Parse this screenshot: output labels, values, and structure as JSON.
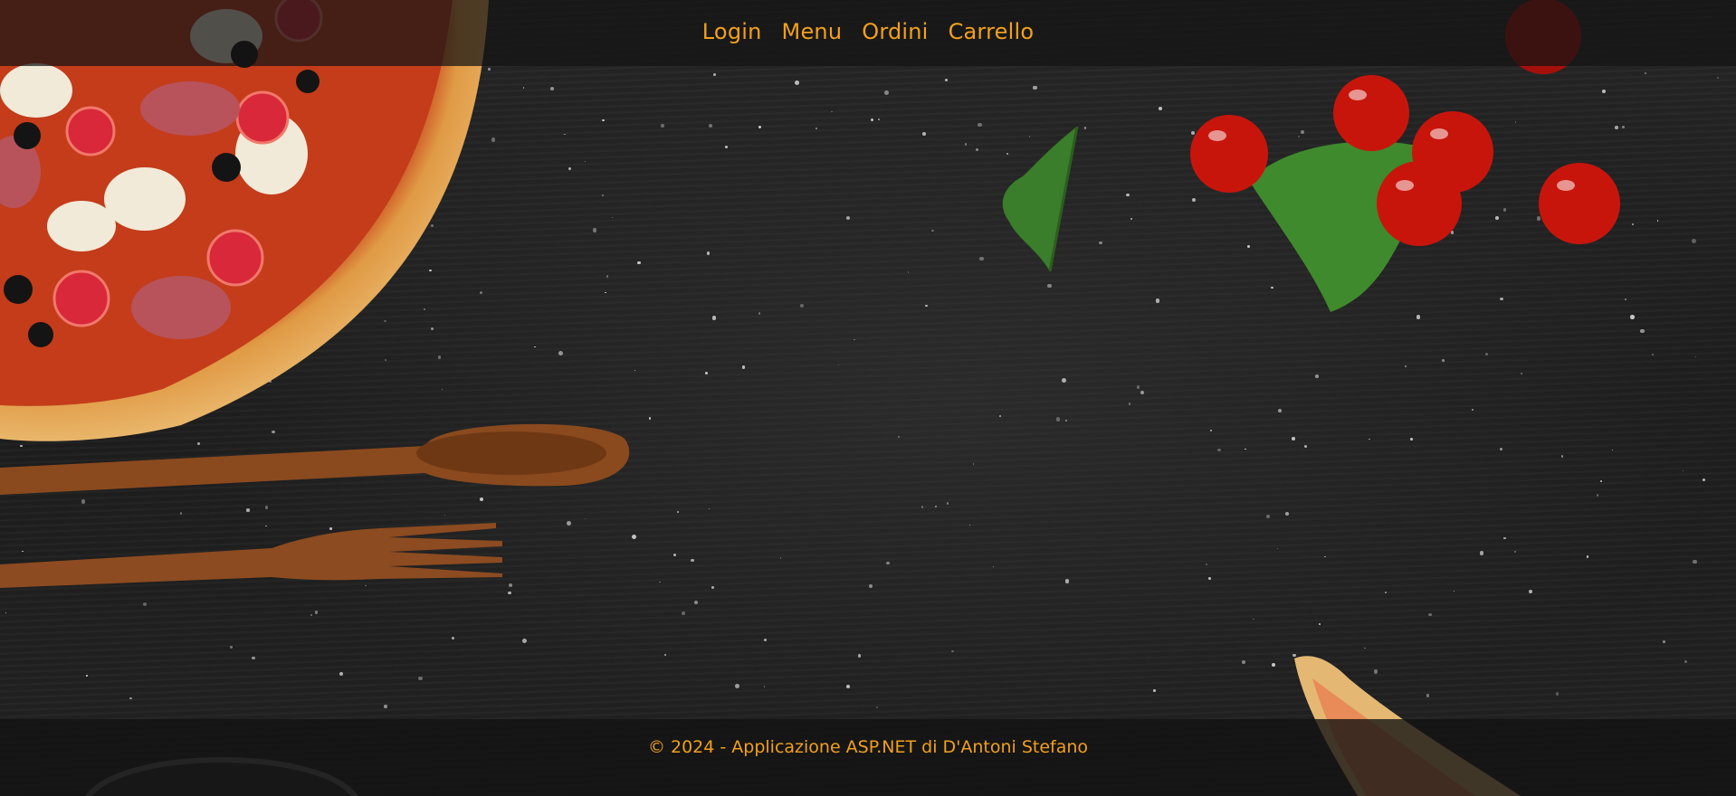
{
  "nav": {
    "items": [
      {
        "label": "Login"
      },
      {
        "label": "Menu"
      },
      {
        "label": "Ordini"
      },
      {
        "label": "Carrello"
      }
    ]
  },
  "footer": {
    "text": "© 2024 - Applicazione ASP.NET di D'Antoni Stefano"
  },
  "colors": {
    "accent": "#f2a01c",
    "background": "#1f1f1f",
    "bar": "#141414"
  },
  "decorations": [
    "pizza",
    "wooden-spoon",
    "wooden-fork",
    "cherry-tomatoes",
    "parsley",
    "pizza-slice",
    "bowl"
  ]
}
